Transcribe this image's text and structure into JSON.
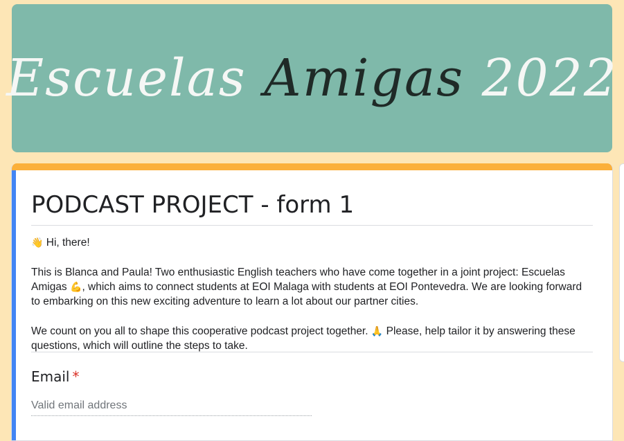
{
  "banner": {
    "word1": "Escuelas",
    "word2": "Amigas",
    "word3": "2022"
  },
  "form": {
    "title": "PODCAST PROJECT - form 1",
    "greeting_icon": "👋",
    "greeting": "Hi, there!",
    "paragraph1_a": "This is Blanca and Paula! Two enthusiastic English teachers who have come together in a joint project: Escuelas Amigas",
    "paragraph1_icon": "💪",
    "paragraph1_b": ", which aims to connect students at EOI Malaga with students at EOI Pontevedra. We are looking forward to embarking on this new exciting adventure to learn a lot about our partner cities.",
    "paragraph2_a": "We count on you all to shape this cooperative podcast project together.",
    "paragraph2_icon": "🙏",
    "paragraph2_b": "Please, help tailor it by answering these questions, which will outline the steps to take."
  },
  "email": {
    "label": "Email",
    "required_mark": "*",
    "placeholder": "Valid email address",
    "value": ""
  },
  "colors": {
    "page_bg": "#fde6b6",
    "banner_bg": "#7fb9aa",
    "card_top_accent": "#fbb03b",
    "card_left_accent": "#4285f4",
    "required": "#d93025"
  }
}
